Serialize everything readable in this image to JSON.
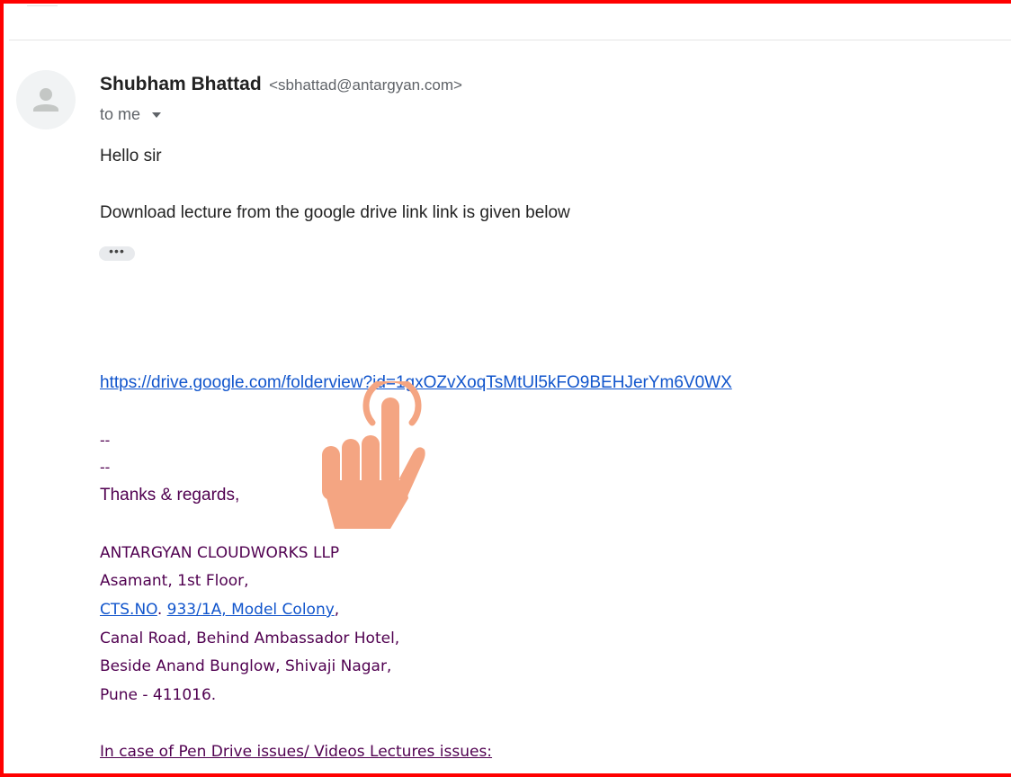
{
  "email": {
    "sender_name": "Shubham Bhattad",
    "sender_email": "<sbhattad@antargyan.com>",
    "recipient": "to me",
    "greeting": "Hello sir",
    "message": "Download lecture from the google drive link link is given below",
    "ellipsis": "•••",
    "link": "https://drive.google.com/folderview?id=1gxOZvXoqTsMtUl5kFO9BEHJerYm6V0WX",
    "dash1": "--",
    "dash2": "--",
    "regards": "Thanks & regards,"
  },
  "signature": {
    "company": "ANTARGYAN CLOUDWORKS LLP",
    "floor": "Asamant, 1st Floor,",
    "cts_link": "CTS.NO",
    "cts_sep": ". ",
    "address_link": "933/1A, Model Colony",
    "address_end": ",",
    "road": "Canal Road, Behind Ambassador Hotel,",
    "area": "Beside Anand Bunglow, Shivaji Nagar,",
    "city": "Pune  - 411016.",
    "support": "In case of Pen Drive issues/ Videos Lectures issues:"
  },
  "icons": {
    "avatar": "person-silhouette-icon",
    "recipient_toggle": "caret-down-icon",
    "pointer": "tapping-hand-icon"
  },
  "colors": {
    "frame": "#ff0000",
    "link": "#1155cc",
    "signature_text": "#500050",
    "hand": "#f4a582"
  }
}
